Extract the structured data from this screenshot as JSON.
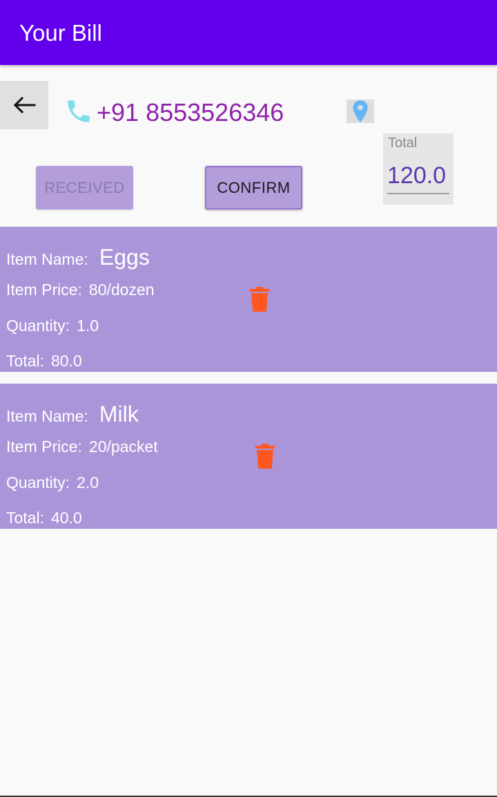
{
  "appbar": {
    "title": "Your Bill"
  },
  "contact": {
    "phone": "+91 8553526346"
  },
  "total": {
    "label": "Total",
    "value": "120.0"
  },
  "buttons": {
    "received": "RECEIVED",
    "confirm": "CONFIRM"
  },
  "labels": {
    "item_name": "Item Name:",
    "item_price": "Item Price:",
    "quantity": "Quantity:",
    "total": "Total:"
  },
  "items": [
    {
      "name": "Eggs",
      "price": "80/dozen",
      "quantity": "1.0",
      "total": "80.0"
    },
    {
      "name": "Milk",
      "price": "20/packet",
      "quantity": "2.0",
      "total": "40.0"
    }
  ],
  "colors": {
    "appbar": "#6200ee",
    "card": "#aa95d9",
    "phone_text": "#8e24aa",
    "delete_icon": "#ff5722",
    "phone_icon": "#80deea",
    "location_icon": "#64b5f6"
  },
  "icons": {
    "back": "arrow-left-icon",
    "phone": "phone-icon",
    "location": "location-pin-icon",
    "delete": "trash-icon"
  }
}
